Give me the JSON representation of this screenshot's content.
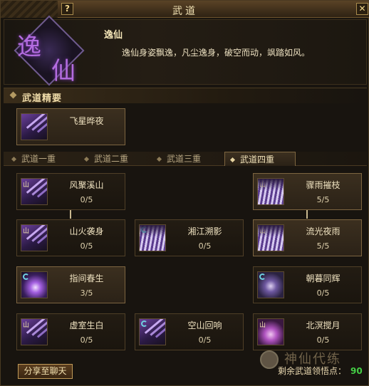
{
  "window": {
    "title": "武道",
    "help_label": "?",
    "close_label": "✕"
  },
  "header": {
    "emblem_char_1": "逸",
    "emblem_char_2": "仙",
    "style_name": "逸仙",
    "style_desc": "逸仙身姿飘逸，凡尘逸身，破空而动，飒踏如风。"
  },
  "essence": {
    "section_label": "武道精要",
    "skill": {
      "name": "飞星晔夜",
      "icon": "flying-star-icon"
    }
  },
  "tabs": [
    {
      "label": "武道一重",
      "active": false
    },
    {
      "label": "武道二重",
      "active": false
    },
    {
      "label": "武道三重",
      "active": false
    },
    {
      "label": "武道四重",
      "active": true
    }
  ],
  "skills": {
    "fengju_xishan": {
      "name": "风聚溪山",
      "level": "0/5",
      "icon": "claw-icon",
      "tag": "山"
    },
    "zhouyu_cuizhi": {
      "name": "骤雨摧枝",
      "level": "5/5",
      "icon": "piano-icon",
      "tag": "山"
    },
    "shanhuo_xishen": {
      "name": "山火袭身",
      "level": "0/5",
      "icon": "claw-icon",
      "tag": "山"
    },
    "xiangjiang_suying": {
      "name": "湘江溯影",
      "level": "0/5",
      "icon": "piano-icon",
      "tag": "ring"
    },
    "liuguang_yeyu": {
      "name": "流光夜雨",
      "level": "5/5",
      "icon": "piano-icon",
      "tag": "山"
    },
    "zhijian_chunsheng": {
      "name": "指间春生",
      "level": "3/5",
      "icon": "orb-icon",
      "tag": "ring"
    },
    "zhaomu_tonghui": {
      "name": "朝暮同辉",
      "level": "0/5",
      "icon": "moon-icon",
      "tag": "ring"
    },
    "xushi_shengbai": {
      "name": "虚室生白",
      "level": "0/5",
      "icon": "claw-icon",
      "tag": "山"
    },
    "kongshan_huixiang": {
      "name": "空山回响",
      "level": "0/5",
      "icon": "claw-icon",
      "tag": "ring"
    },
    "beiming_jiaoyue": {
      "name": "北溟搅月",
      "level": "0/5",
      "icon": "flower-icon",
      "tag": "山"
    }
  },
  "footer": {
    "share_label": "分享至聊天",
    "remaining_label": "剩余武道领悟点：",
    "remaining_points": "90",
    "watermark": "神仙代练"
  },
  "colors": {
    "accent": "#c09a58",
    "points_green": "#45d046",
    "title_gold": "#f3e3b4"
  }
}
